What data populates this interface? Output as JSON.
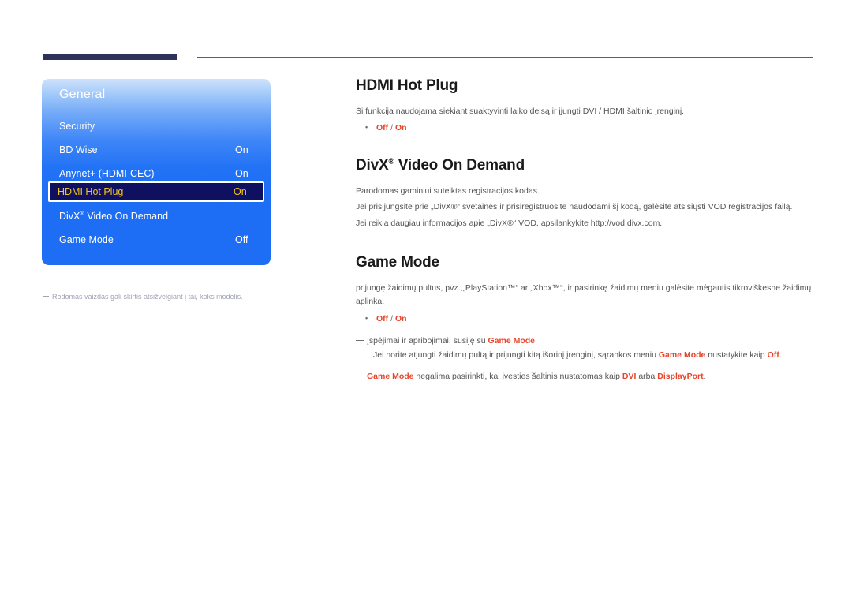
{
  "header": {
    "rule_thick_color": "#2e3259",
    "rule_thin_color": "#5a5b77"
  },
  "osd": {
    "title": "General",
    "accent_blue": "#1e6ef5",
    "selected_bg": "#101060",
    "selected_text": "#f5c518",
    "rows": [
      {
        "label": "Security",
        "value": "",
        "selected": false
      },
      {
        "label": "BD Wise",
        "value": "On",
        "selected": false
      },
      {
        "label": "Anynet+ (HDMI-CEC)",
        "value": "On",
        "selected": false
      },
      {
        "label": "HDMI Hot Plug",
        "value": "On",
        "selected": true
      },
      {
        "label": "DivX",
        "label_sup": "®",
        "label_tail": " Video On Demand",
        "value": "",
        "selected": false
      },
      {
        "label": "Game Mode",
        "value": "Off",
        "selected": false
      }
    ]
  },
  "footnote": {
    "text": "Rodomas vaizdas gali skirtis atsižvelgiant į tai, koks modelis."
  },
  "content": {
    "accent_color": "#e8452b",
    "sections": [
      {
        "title": "HDMI Hot Plug",
        "title_sup": "",
        "paragraphs": [
          "Ši funkcija naudojama siekiant suaktyvinti laiko delsą ir įjungti DVI / HDMI šaltinio įrenginį."
        ],
        "options": {
          "off": "Off",
          "sep": " / ",
          "on": "On"
        }
      },
      {
        "title": "DivX",
        "title_sup": "®",
        "title_tail": " Video On Demand",
        "paragraphs": [
          "Parodomas gaminiui suteiktas registracijos kodas.",
          "Jei prisijungsite prie „DivX®“ svetainės ir prisiregistruosite naudodami šį kodą, galėsite atsisiųsti VOD registracijos failą.",
          "Jei reikia daugiau informacijos apie „DivX®“ VOD, apsilankykite http://vod.divx.com."
        ]
      },
      {
        "title": "Game Mode",
        "paragraphs": [
          "prijungę žaidimų pultus, pvz.,„PlayStation™“ ar „Xbox™“, ir pasirinkę žaidimų meniu galėsite mėgautis tikroviškesne žaidimų aplinka."
        ],
        "options": {
          "off": "Off",
          "sep": " / ",
          "on": "On"
        }
      }
    ],
    "notes": [
      {
        "lead": "Įspėjimai ir apribojimai, susiję su ",
        "lead_accent": "Game Mode",
        "sub_parts": [
          {
            "text": "Jei norite atjungti žaidimų pultą ir prijungti kitą išorinį įrenginį, sąrankos meniu ",
            "accent": false
          },
          {
            "text": "Game Mode",
            "accent": true
          },
          {
            "text": " nustatykite kaip ",
            "accent": false
          },
          {
            "text": "Off",
            "accent": true
          },
          {
            "text": ".",
            "accent": false
          }
        ]
      },
      {
        "parts": [
          {
            "text": "Game Mode",
            "accent": true
          },
          {
            "text": " negalima pasirinkti, kai įvesties šaltinis nustatomas kaip ",
            "accent": false
          },
          {
            "text": "DVI",
            "accent": true
          },
          {
            "text": " arba ",
            "accent": false
          },
          {
            "text": "DisplayPort",
            "accent": true
          },
          {
            "text": ".",
            "accent": false
          }
        ]
      }
    ]
  }
}
